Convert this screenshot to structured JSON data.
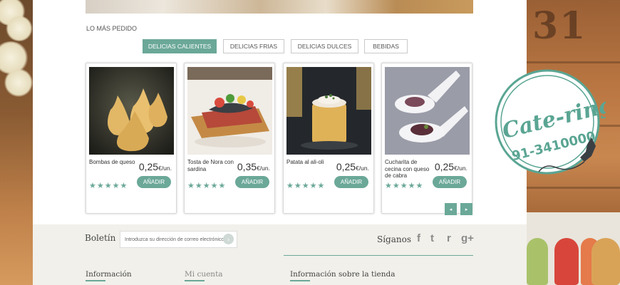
{
  "section": {
    "title": "LO MÁS PEDIDO"
  },
  "tabs": [
    {
      "label": "DELICIAS CALIENTES",
      "active": true
    },
    {
      "label": "DELICIAS FRIAS",
      "active": false
    },
    {
      "label": "DELICIAS DULCES",
      "active": false
    },
    {
      "label": "BEBIDAS",
      "active": false
    }
  ],
  "products": [
    {
      "name": "Bombas de queso",
      "price": "0,25",
      "unit": "€/un.",
      "rating": 5,
      "button": "AÑADIR"
    },
    {
      "name": "Tosta de Nora con sardina",
      "price": "0,35",
      "unit": "€/un.",
      "rating": 5,
      "button": "AÑADIR"
    },
    {
      "name": "Patata al ali-oli",
      "price": "0,25",
      "unit": "€/un.",
      "rating": 5,
      "button": "AÑADIR"
    },
    {
      "name": "Cucharita de cecina con queso de cabra",
      "price": "0,25",
      "unit": "€/un.",
      "rating": 5,
      "button": "AÑADIR"
    }
  ],
  "pager": {
    "prev": "◂",
    "next": "▸"
  },
  "stamp": {
    "line1": "Cate-ring",
    "phone": "91-3410000"
  },
  "footer": {
    "newsletter_label": "Boletín",
    "newsletter_placeholder": "Introduzca su dirección de correo electrónico",
    "newsletter_go": "›",
    "follow_label": "Síganos",
    "social": [
      {
        "icon": "facebook-icon",
        "glyph": "f"
      },
      {
        "icon": "twitter-icon",
        "glyph": "t"
      },
      {
        "icon": "rss-icon",
        "glyph": "r"
      },
      {
        "icon": "google-plus-icon",
        "glyph": "g+"
      }
    ],
    "columns": [
      "Información",
      "Mi cuenta",
      "Información sobre la tienda"
    ]
  },
  "colors": {
    "accent": "#6ba898"
  }
}
